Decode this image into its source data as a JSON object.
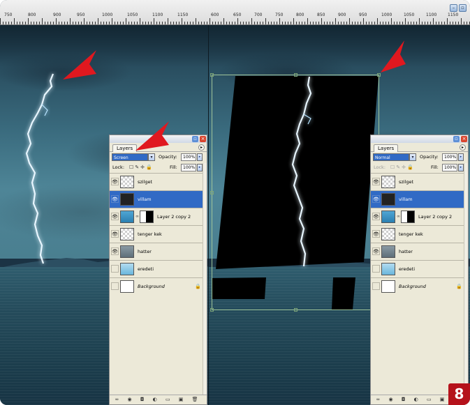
{
  "ruler": {
    "labels": [
      "750",
      "800",
      "900",
      "950",
      "1000",
      "1050",
      "1100",
      "1150",
      "600",
      "650",
      "700",
      "750",
      "800",
      "850",
      "900",
      "950",
      "1000",
      "1050",
      "1100",
      "1150"
    ]
  },
  "left_panel": {
    "tab_label": "Layers",
    "blend_mode": "Screen",
    "opacity_label": "Opacity:",
    "opacity_value": "100%",
    "lock_label": "Lock:",
    "fill_label": "Fill:",
    "fill_value": "100%",
    "layers": [
      {
        "name": "szilget",
        "thumb": "checker",
        "visible": true,
        "selected": false
      },
      {
        "name": "villam",
        "thumb": "dark",
        "visible": true,
        "selected": true
      },
      {
        "name": "Layer 2 copy 2",
        "thumb": "blue",
        "visible": true,
        "selected": false,
        "mask": true
      },
      {
        "name": "tenger kek",
        "thumb": "checker",
        "visible": true,
        "selected": false
      },
      {
        "name": "hatter",
        "thumb": "grey",
        "visible": true,
        "selected": false
      },
      {
        "name": "eredeti",
        "thumb": "sky",
        "visible": false,
        "selected": false
      },
      {
        "name": "Background",
        "thumb": "white",
        "visible": false,
        "selected": false,
        "italic": true,
        "locked": true
      }
    ]
  },
  "right_panel": {
    "tab_label": "Layers",
    "blend_mode": "Normal",
    "opacity_label": "Opacity:",
    "opacity_value": "100%",
    "lock_label": "Lock:",
    "fill_label": "Fill:",
    "fill_value": "100%",
    "layers": [
      {
        "name": "szilget",
        "thumb": "checker",
        "visible": true,
        "selected": false
      },
      {
        "name": "villam",
        "thumb": "dark",
        "visible": true,
        "selected": true
      },
      {
        "name": "Layer 2 copy 2",
        "thumb": "blue",
        "visible": true,
        "selected": false,
        "mask": true
      },
      {
        "name": "tenger kek",
        "thumb": "checker",
        "visible": true,
        "selected": false
      },
      {
        "name": "hatter",
        "thumb": "grey",
        "visible": true,
        "selected": false
      },
      {
        "name": "eredeti",
        "thumb": "sky",
        "visible": false,
        "selected": false
      },
      {
        "name": "Background",
        "thumb": "white",
        "visible": false,
        "selected": false,
        "italic": true,
        "locked": true
      }
    ]
  },
  "badge": {
    "number": "8"
  },
  "colors": {
    "selection_blue": "#316ac5",
    "panel_bg": "#ece9d8",
    "arrow_red": "#e0181f",
    "badge_red": "#b5121b"
  },
  "icons": {
    "eye": "eye-icon",
    "lock": "lock-icon",
    "chain": "link-icon",
    "minimize": "minimize-icon",
    "close": "close-icon"
  }
}
